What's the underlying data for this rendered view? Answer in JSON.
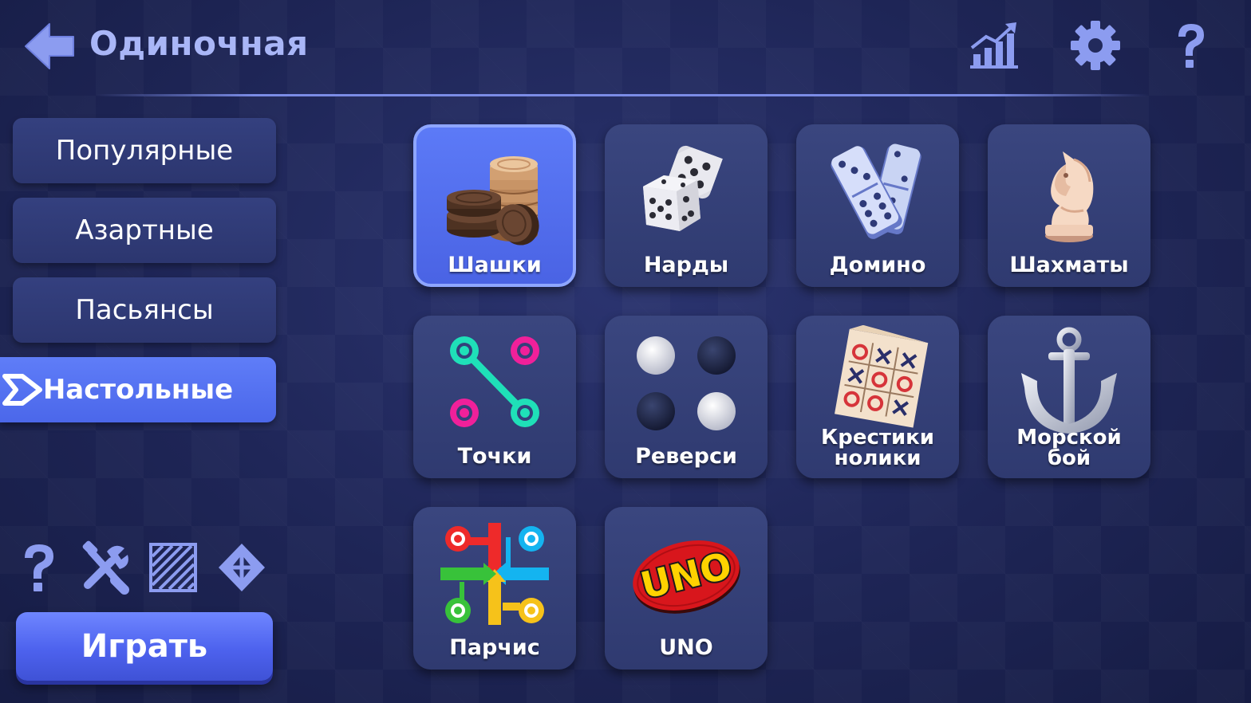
{
  "header": {
    "title": "Одиночная",
    "back_icon": "back-arrow-icon",
    "stats_icon": "stats-chart-icon",
    "settings_icon": "gear-icon",
    "help_icon": "question-icon"
  },
  "sidebar": {
    "categories": [
      {
        "label": "Популярные",
        "active": false
      },
      {
        "label": "Азартные",
        "active": false
      },
      {
        "label": "Пасьянсы",
        "active": false
      },
      {
        "label": "Настольные",
        "active": true
      }
    ],
    "tools": [
      "question-icon",
      "tools-icon",
      "hatch-pattern-icon",
      "diamond-icon"
    ],
    "play_label": "Играть"
  },
  "games": [
    {
      "label": "Шашки",
      "icon": "checkers-icon",
      "selected": true
    },
    {
      "label": "Нарды",
      "icon": "dice-icon",
      "selected": false
    },
    {
      "label": "Домино",
      "icon": "domino-icon",
      "selected": false
    },
    {
      "label": "Шахматы",
      "icon": "chess-knight-icon",
      "selected": false
    },
    {
      "label": "Точки",
      "icon": "dots-icon",
      "selected": false
    },
    {
      "label": "Реверси",
      "icon": "reversi-icon",
      "selected": false
    },
    {
      "label_line1": "Крестики",
      "label_line2": "нолики",
      "icon": "tic-tac-toe-icon",
      "selected": false
    },
    {
      "label_line1": "Морской",
      "label_line2": "бой",
      "icon": "anchor-icon",
      "selected": false
    },
    {
      "label": "Парчис",
      "icon": "parcheesi-icon",
      "selected": false
    },
    {
      "label": "UNO",
      "logo_text": "UNO",
      "icon": "uno-logo-icon",
      "selected": false
    }
  ],
  "colors": {
    "accent": "#5a74f5",
    "title": "#a9b6f7",
    "background": "#1e2556",
    "tile": "#34407a"
  }
}
